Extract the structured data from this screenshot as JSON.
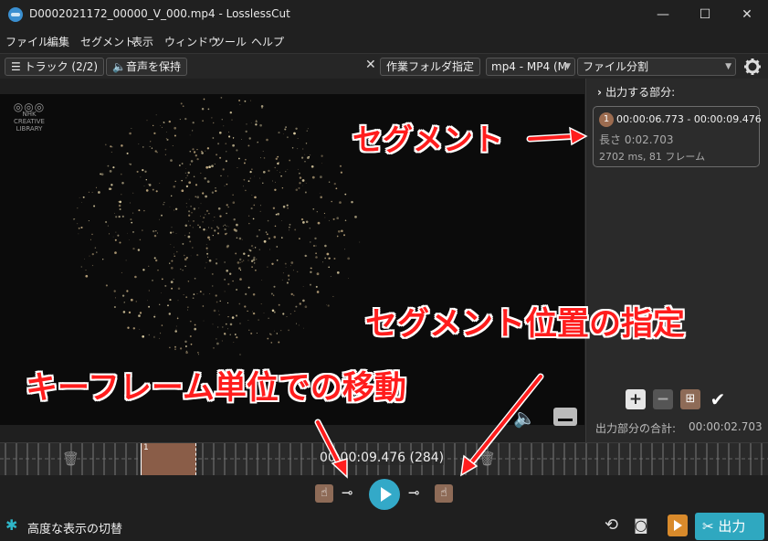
{
  "window": {
    "title": "D0002021172_00000_V_000.mp4 - LosslessCut",
    "minimize": "—",
    "maximize": "☐",
    "close": "✕"
  },
  "menu": [
    "ファイル",
    "編集",
    "セグメント",
    "表示",
    "ウィンドウ",
    "ツール",
    "ヘルプ"
  ],
  "toolbar": {
    "tracks_label": "トラック (2/2)",
    "keep_audio_label": "音声を保持",
    "clear_x": "✕",
    "workdir_label": "作業フォルダ指定",
    "format_value": "mp4 - MP4 (M",
    "export_mode_value": "ファイル分割",
    "settings_icon": "gear-icon"
  },
  "video": {
    "logo_text": "NHK CREATIVE LIBRARY"
  },
  "segments_panel": {
    "title": "出力する部分:",
    "segment": {
      "index": "1",
      "range": "00:00:06.773 - 00:00:09.476",
      "duration": "長さ 0:02.703",
      "frames": "2702 ms, 81 フレーム"
    },
    "total_label": "出力部分の合計:",
    "total_value": "00:00:02.703"
  },
  "timeline": {
    "segment_label": "1",
    "current_time": "00:00:09.476 (284)"
  },
  "bottom": {
    "advanced_toggle": "高度な表示の切替",
    "export_label": "出力"
  },
  "annotations": {
    "segment": "セグメント",
    "segment_position": "セグメント位置の指定",
    "keyframe_move": "キーフレーム単位での移動"
  },
  "colors": {
    "accent": "#33a9c8",
    "segment": "#8a5d48",
    "annotation": "#ff1d1d"
  }
}
